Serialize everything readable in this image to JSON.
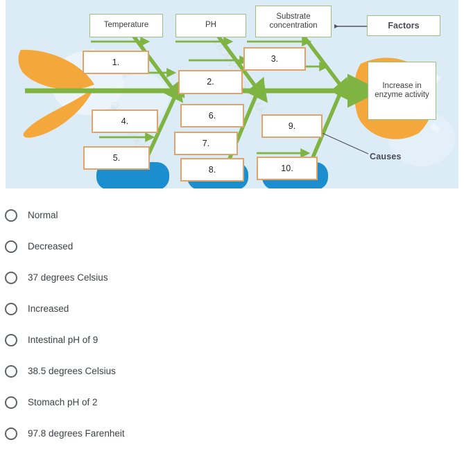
{
  "diagram": {
    "name": "fishbone-diagram",
    "background_color": "#dcecf7",
    "spine_color": "#7fb342",
    "bone_color": "#7fb342",
    "box_border_orange": "#e0a369",
    "box_border_green": "#9bbf7e",
    "tail_color": "#f4a83c",
    "accent_blue": "#1b8ed0",
    "watermark_text": "OLANSIXSIGMA.co",
    "factor_labels": [
      {
        "id": "temperature",
        "text": "Temperature"
      },
      {
        "id": "ph",
        "text": "PH"
      },
      {
        "id": "substrate-concentration",
        "text": "Substrate concentration"
      }
    ],
    "factors_callout": "Factors",
    "causes_callout": "Causes",
    "effect": "Increase in enzyme activity",
    "numbered_boxes": [
      {
        "id": "blank-1",
        "text": "1."
      },
      {
        "id": "blank-2",
        "text": "2."
      },
      {
        "id": "blank-3",
        "text": "3."
      },
      {
        "id": "blank-4",
        "text": "4."
      },
      {
        "id": "blank-5",
        "text": "5."
      },
      {
        "id": "blank-6",
        "text": "6."
      },
      {
        "id": "blank-7",
        "text": "7."
      },
      {
        "id": "blank-8",
        "text": "8."
      },
      {
        "id": "blank-9",
        "text": "9."
      },
      {
        "id": "blank-10",
        "text": "10."
      }
    ]
  },
  "options": {
    "items": [
      {
        "id": "option-normal",
        "label": "Normal"
      },
      {
        "id": "option-decreased",
        "label": "Decreased"
      },
      {
        "id": "option-37-celsius",
        "label": "37 degrees Celsius"
      },
      {
        "id": "option-increased",
        "label": "Increased"
      },
      {
        "id": "option-intestinal-ph-9",
        "label": "Intestinal pH of 9"
      },
      {
        "id": "option-38-5-celsius",
        "label": "38.5 degrees Celsius"
      },
      {
        "id": "option-stomach-ph-2",
        "label": "Stomach pH of 2"
      },
      {
        "id": "option-97-8-farenheit",
        "label": "97.8 degrees Farenheit"
      }
    ]
  }
}
